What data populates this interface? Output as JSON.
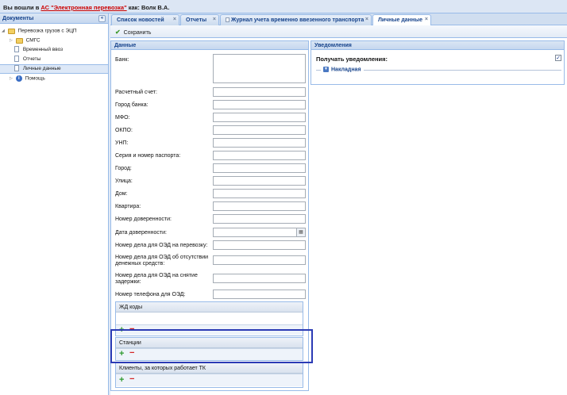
{
  "header": {
    "prefix": "Вы вошли в",
    "system_link": "АС \"Электронная перевозка\"",
    "suffix": "как: Волк В.А."
  },
  "sidebar": {
    "title": "Документы",
    "collapse_glyph": "«",
    "items": [
      {
        "label": "Перевозка грузов с ЭЦП",
        "icon": "folder-icon"
      },
      {
        "label": "СМГС",
        "icon": "folder-icon"
      },
      {
        "label": "Временный ввоз",
        "icon": "document-icon"
      },
      {
        "label": "Отчеты",
        "icon": "document-icon"
      },
      {
        "label": "Личные данные",
        "icon": "document-icon"
      },
      {
        "label": "Помощь",
        "icon": "info-icon"
      }
    ]
  },
  "tabs": [
    {
      "label": "Список новостей"
    },
    {
      "label": "Отчеты"
    },
    {
      "label": "Журнал учета временно ввезенного транспорта"
    },
    {
      "label": "Личные данные"
    }
  ],
  "toolbar": {
    "save_label": "Сохранить"
  },
  "data_panel": {
    "title": "Данные",
    "fields": [
      {
        "label": "Банк:",
        "value": ""
      },
      {
        "label": "Расчетный счет:",
        "value": ""
      },
      {
        "label": "Город банка:",
        "value": ""
      },
      {
        "label": "МФО:",
        "value": ""
      },
      {
        "label": "ОКПО:",
        "value": ""
      },
      {
        "label": "УНП:",
        "value": ""
      },
      {
        "label": "Серия и номер паспорта:",
        "value": ""
      },
      {
        "label": "Город:",
        "value": ""
      },
      {
        "label": "Улица:",
        "value": ""
      },
      {
        "label": "Дом:",
        "value": ""
      },
      {
        "label": "Квартира:",
        "value": ""
      },
      {
        "label": "Номер доверенности:",
        "value": ""
      },
      {
        "label": "Дата доверенности:",
        "value": ""
      },
      {
        "label": "Номер дела для ОЭД на перевозку:",
        "value": ""
      },
      {
        "label": "Номер дела для ОЭД об отсутствии денежных средств:",
        "value": ""
      },
      {
        "label": "Номер дела для ОЭД на снятие задержки:",
        "value": ""
      },
      {
        "label": "Номер телефона для ОЭД:",
        "value": ""
      }
    ],
    "grids": [
      {
        "title": "ЖД коды"
      },
      {
        "title": "Станции"
      },
      {
        "title": "Клиенты, за которых работает ТК"
      }
    ],
    "add_glyph": "+",
    "remove_glyph": "−"
  },
  "notifications": {
    "title": "Уведомления",
    "receive_label": "Получать уведомления:",
    "receive_checked": true,
    "check_glyph": "✓",
    "group_label": "Накладная"
  },
  "colors": {
    "accent": "#15428b",
    "border": "#99bbe8",
    "highlight": "#2b3bb5",
    "add": "#2e9a2e",
    "remove": "#d42222"
  }
}
